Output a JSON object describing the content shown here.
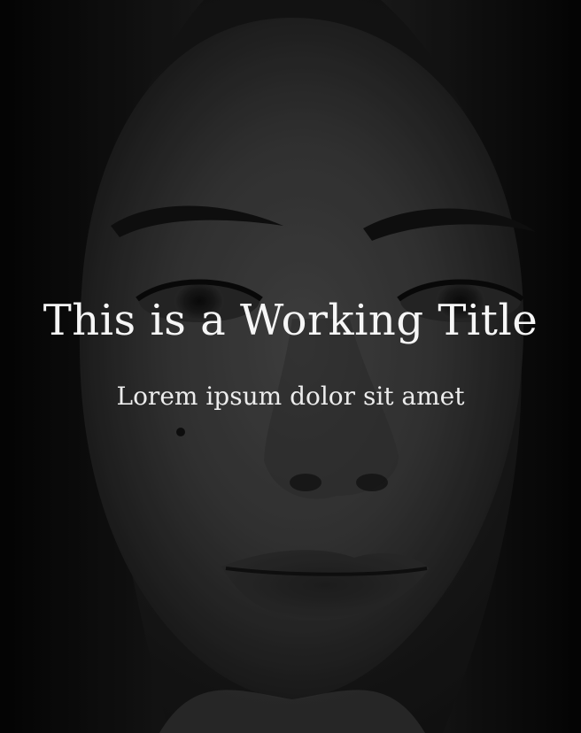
{
  "hero": {
    "title": "This is a Working Title",
    "subtitle": "Lorem ipsum dolor sit amet"
  },
  "colors": {
    "background": "#121212",
    "text": "#f6f6f6"
  }
}
